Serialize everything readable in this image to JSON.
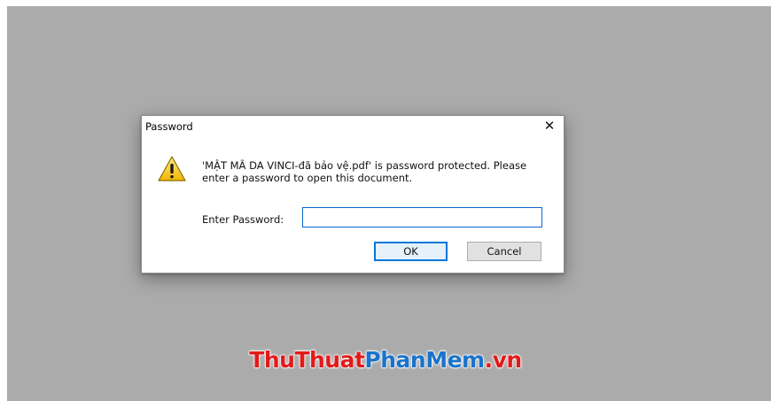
{
  "dialog": {
    "title": "Password",
    "close_glyph": "✕",
    "icon": "warning-triangle-icon",
    "message": "'MẬT MÃ DA VINCI-đã bảo vệ.pdf' is password protected. Please enter a password to open this document.",
    "password_label": "Enter Password:",
    "password_value": "",
    "ok_label": "OK",
    "cancel_label": "Cancel"
  },
  "watermark": {
    "part1": "ThuThuat",
    "part2": "PhanMem",
    "part3": ".vn"
  },
  "colors": {
    "backdrop": "#ababab",
    "input_border": "#0a67c9",
    "ok_border": "#0078d7",
    "watermark_red": "#e21a1a",
    "watermark_blue": "#1a73c9"
  }
}
